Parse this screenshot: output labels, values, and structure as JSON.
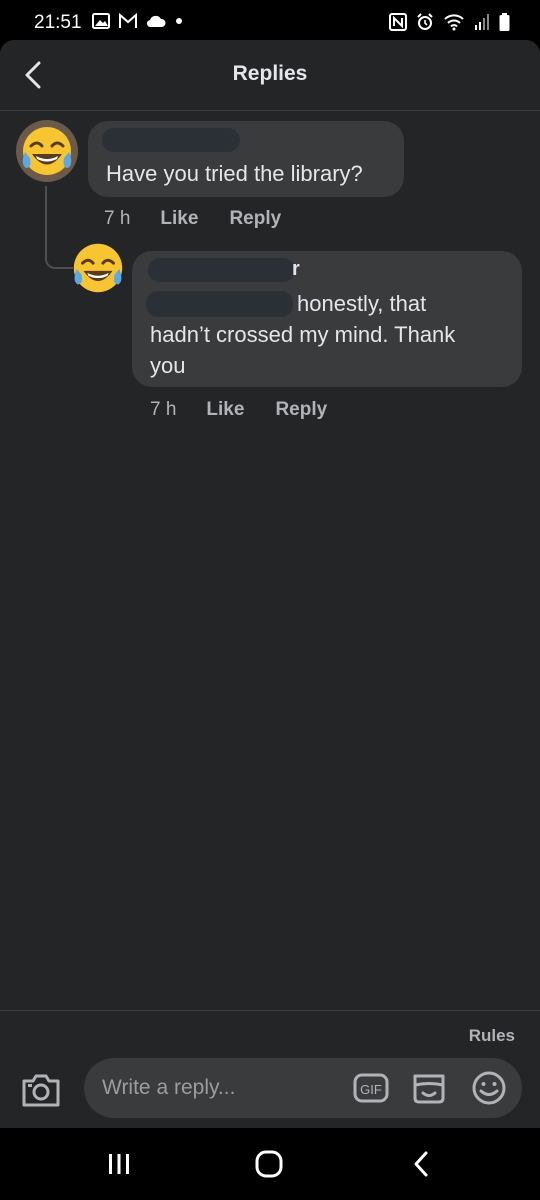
{
  "status_bar": {
    "time": "21:51",
    "left_icons": [
      "gallery-icon",
      "gmail-icon",
      "cloud-icon",
      "dot-icon"
    ],
    "right_icons": [
      "nfc-icon",
      "alarm-icon",
      "wifi-icon",
      "signal-icon",
      "battery-icon"
    ]
  },
  "header": {
    "title": "Replies",
    "back_icon": "chevron-left-icon"
  },
  "comments": [
    {
      "avatar": "tears-of-joy-emoji",
      "author": "",
      "text": "Have you tried the library?",
      "time": "7 h",
      "like_label": "Like",
      "reply_label": "Reply"
    },
    {
      "avatar": "tears-of-joy-emoji",
      "author_suffix": "r",
      "text_line1": "honestly, that",
      "text_line2": "hadn’t crossed my mind. Thank",
      "text_line3": "you",
      "time": "7 h",
      "like_label": "Like",
      "reply_label": "Reply"
    }
  ],
  "footer": {
    "rules_label": "Rules",
    "reply_placeholder": "Write a reply...",
    "camera_icon": "camera-icon",
    "gif_icon": "gif-icon",
    "sticker_icon": "sticker-icon",
    "emoji_icon": "emoji-icon"
  },
  "nav_bar": {
    "icons": [
      "recents-icon",
      "home-icon",
      "back-icon"
    ]
  },
  "colors": {
    "background": "#242526",
    "bubble": "#3a3b3c",
    "text": "#e4e6eb",
    "secondary_text": "#b0b3b8"
  }
}
